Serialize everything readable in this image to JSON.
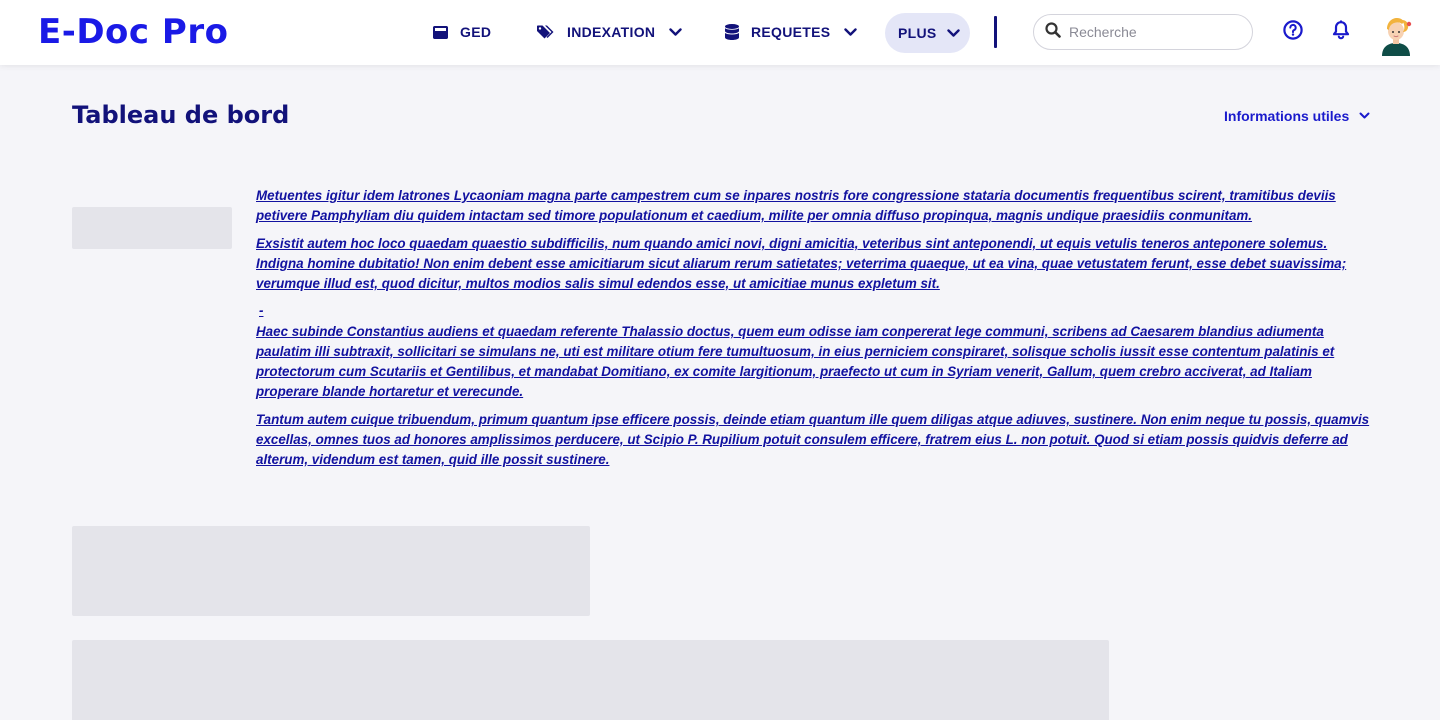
{
  "app": {
    "logo": "E-Doc Pro"
  },
  "nav": {
    "ged": "GED",
    "indexation": "INDEXATION",
    "requetes": "REQUETES",
    "plus": "PLUS"
  },
  "search": {
    "placeholder": "Recherche",
    "value": ""
  },
  "page": {
    "title": "Tableau de bord",
    "info_toggle": "Informations utiles"
  },
  "info": {
    "paragraphs": [
      "Metuentes igitur idem latrones Lycaoniam magna parte campestrem cum se inpares nostris fore congressione stataria documentis frequentibus scirent, tramitibus deviis petivere Pamphyliam diu quidem intactam sed timore populationum et caedium, milite per omnia diffuso propinqua, magnis undique praesidiis conmunitam.",
      "Exsistit autem hoc loco quaedam quaestio subdifficilis, num quando amici novi, digni amicitia, veteribus sint anteponendi, ut equis vetulis teneros anteponere solemus. Indigna homine dubitatio! Non enim debent esse amicitiarum sicut aliarum rerum satietates; veterrima quaeque, ut ea vina, quae vetustatem ferunt, esse debet suavissima; verumque illud est, quod dicitur, multos modios salis simul edendos esse, ut amicitiae munus expletum sit.",
      "-",
      "Haec subinde Constantius audiens et quaedam referente Thalassio doctus, quem eum odisse iam conpererat lege communi, scribens ad Caesarem blandius adiumenta paulatim illi subtraxit, sollicitari se simulans ne, uti est militare otium fere tumultuosum, in eius perniciem conspiraret, solisque scholis iussit esse contentum palatinis et protectorum cum Scutariis et Gentilibus, et mandabat Domitiano, ex comite largitionum, praefecto ut cum in Syriam venerit, Gallum, quem crebro acciverat, ad Italiam properare blande hortaretur et verecunde.",
      "Tantum autem cuique tribuendum, primum quantum ipse efficere possis, deinde etiam quantum ille quem diligas atque adiuves, sustinere. Non enim neque tu possis, quamvis excellas, omnes tuos ad honores amplissimos perducere, ut Scipio P. Rupilium potuit consulem efficere, fratrem eius L. non potuit. Quod si etiam possis quidvis deferre ad alterum, videndum est tamen, quid ille possit sustinere."
    ]
  },
  "icons": {
    "ged": "folder-icon",
    "indexation": "tags-icon",
    "requetes": "database-icon",
    "search": "search-icon",
    "help": "help-circle-icon",
    "bell": "bell-icon",
    "chevron": "chevron-down-icon"
  },
  "colors": {
    "brand": "#1a1ae6",
    "navy": "#12127a",
    "link": "#1212a0",
    "active_pill": "#e4e6f7",
    "background": "#f5f5f9",
    "skeleton": "#e4e4ea"
  }
}
